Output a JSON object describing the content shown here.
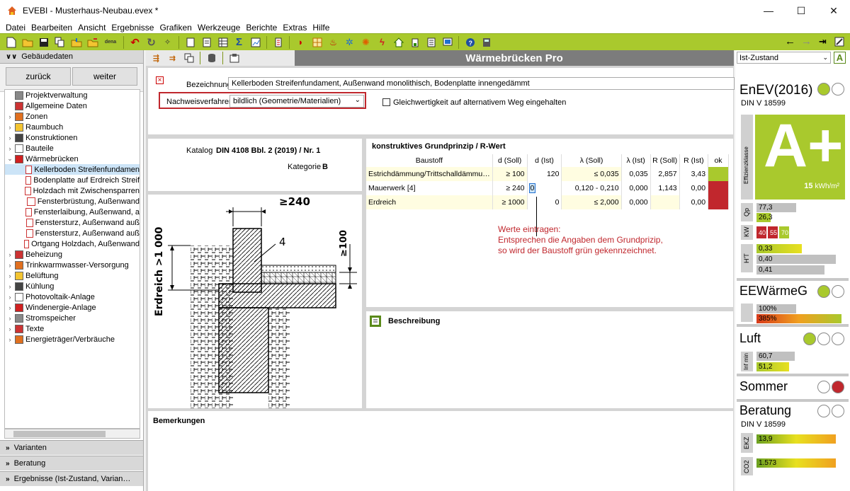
{
  "window": {
    "title": "EVEBI - Musterhaus-Neubau.evex *",
    "controls": [
      "—",
      "☐",
      "✕"
    ]
  },
  "menu": [
    "Datei",
    "Bearbeiten",
    "Ansicht",
    "Ergebnisse",
    "Grafiken",
    "Werkzeuge",
    "Berichte",
    "Extras",
    "Hilfe"
  ],
  "toolbar": {
    "dena_label": "dena"
  },
  "left": {
    "header": "Gebäudedaten",
    "back": "zurück",
    "next": "weiter",
    "tree": [
      {
        "label": "Projektverwaltung",
        "level": 0,
        "exp": ""
      },
      {
        "label": "Allgemeine Daten",
        "level": 0,
        "exp": ""
      },
      {
        "label": "Zonen",
        "level": 0,
        "exp": ">"
      },
      {
        "label": "Raumbuch",
        "level": 0,
        "exp": ">"
      },
      {
        "label": "Konstruktionen",
        "level": 0,
        "exp": ">"
      },
      {
        "label": "Bauteile",
        "level": 0,
        "exp": ">"
      },
      {
        "label": "Wärmebrücken",
        "level": 0,
        "exp": "v"
      },
      {
        "label": "Kellerboden Streifenfundamen",
        "level": 1,
        "exp": "",
        "sel": true
      },
      {
        "label": "Bodenplatte auf Erdreich Streif",
        "level": 1,
        "exp": ""
      },
      {
        "label": "Holzdach mit Zwischensparren",
        "level": 1,
        "exp": ""
      },
      {
        "label": "Fensterbrüstung, Außenwand",
        "level": 1,
        "exp": ""
      },
      {
        "label": "Fensterlaibung, Außenwand, a",
        "level": 1,
        "exp": ""
      },
      {
        "label": "Fenstersturz, Außenwand auß",
        "level": 1,
        "exp": ""
      },
      {
        "label": "Fenstersturz, Außenwand auß",
        "level": 1,
        "exp": ""
      },
      {
        "label": "Ortgang Holzdach, Außenwand",
        "level": 1,
        "exp": ""
      },
      {
        "label": "Beheizung",
        "level": 0,
        "exp": ">"
      },
      {
        "label": "Trinkwarmwasser-Versorgung",
        "level": 0,
        "exp": ">"
      },
      {
        "label": "Belüftung",
        "level": 0,
        "exp": ">"
      },
      {
        "label": "Kühlung",
        "level": 0,
        "exp": ">"
      },
      {
        "label": "Photovoltaik-Anlage",
        "level": 0,
        "exp": ">"
      },
      {
        "label": "Windenergie-Anlage",
        "level": 0,
        "exp": ">"
      },
      {
        "label": "Stromspeicher",
        "level": 0,
        "exp": ">"
      },
      {
        "label": "Texte",
        "level": 0,
        "exp": ">"
      },
      {
        "label": "Energieträger/Verbräuche",
        "level": 0,
        "exp": ">"
      }
    ],
    "bottom": [
      "Varianten",
      "Beratung",
      "Ergebnisse (Ist-Zustand, Varian…"
    ]
  },
  "center": {
    "title": "Wärmebrücken Pro",
    "bez_label": "Bezeichnung",
    "bez_value": "Kellerboden Streifenfundament, Außenwand monolithisch, Bodenplatte innengedämmt",
    "nach_label": "Nachweisverfahren",
    "nach_value": "bildlich (Geometrie/Materialien)",
    "gleich_label": "Gleichwertigkeit auf alternativem Weg eingehalten",
    "katalog_label": "Katalog",
    "katalog_value": "DIN 4108 Bbl. 2 (2019) / Nr. 1",
    "kategorie_label": "Kategorie",
    "kategorie_value": "B",
    "drawing": {
      "top_dim": "≥240",
      "left_dim": "Erdreich >1 000",
      "right_dim": "≥100",
      "num": "4"
    },
    "grund_title": "konstruktives Grundprinzip / R-Wert",
    "cols": [
      "Baustoff",
      "d (Soll)",
      "d (Ist)",
      "λ (Soll)",
      "λ (Ist)",
      "R (Soll)",
      "R (Ist)",
      "ok"
    ],
    "rows": [
      {
        "baustoff": "Estrichdämmung/Trittschalldämmu…",
        "d_soll": "≥ 100",
        "d_ist": "120",
        "l_soll": "≤ 0,035",
        "l_ist": "0,035",
        "r_soll": "2,857",
        "r_ist": "3,43",
        "ok": "#a9c92d"
      },
      {
        "baustoff": "Mauerwerk [4]",
        "d_soll": "≥ 240",
        "d_ist": "0",
        "l_soll": "0,120 - 0,210",
        "l_ist": "0,000",
        "r_soll": "1,143",
        "r_ist": "0,00",
        "ok": "#c1272d"
      },
      {
        "baustoff": "Erdreich",
        "d_soll": "≥ 1000",
        "d_ist": "0",
        "l_soll": "≤ 2,000",
        "l_ist": "0,000",
        "r_soll": "",
        "r_ist": "0,00",
        "ok": "#c1272d"
      }
    ],
    "annotation": [
      "Werte eintragen:",
      "Entsprechen die Angaben dem Grundprizip,",
      "so wird der Baustoff grün gekennzeichnet."
    ],
    "beschreibung": "Beschreibung",
    "bemerkungen": "Bemerkungen"
  },
  "right": {
    "state": "Ist-Zustand",
    "a_btn": "A",
    "enev_title": "EnEV(2016)",
    "enev_sub": "DIN V 18599",
    "effizienz": "Effizienzklasse",
    "klasse": "A+",
    "kwh_value": "15",
    "kwh_unit": "kWh/m²",
    "qp_label": "Qp",
    "qp": [
      "77,3",
      "26,3"
    ],
    "kw_label": "KW",
    "kw": [
      "40",
      "55",
      "70"
    ],
    "ht_label": "H'T",
    "ht": [
      "0,33",
      "0,40",
      "0,41"
    ],
    "ee_title": "EEWärmeG",
    "ee": [
      "100%",
      "385%"
    ],
    "luft_title": "Luft",
    "inf_label": "Inf min",
    "luft": [
      "60,7",
      "51,2"
    ],
    "sommer_title": "Sommer",
    "beratung_title": "Beratung",
    "beratung_sub": "DIN V 18599",
    "ekz_label": "EKZ",
    "ekz": "13,9",
    "co2_label": "CO2",
    "co2": "1.573"
  }
}
